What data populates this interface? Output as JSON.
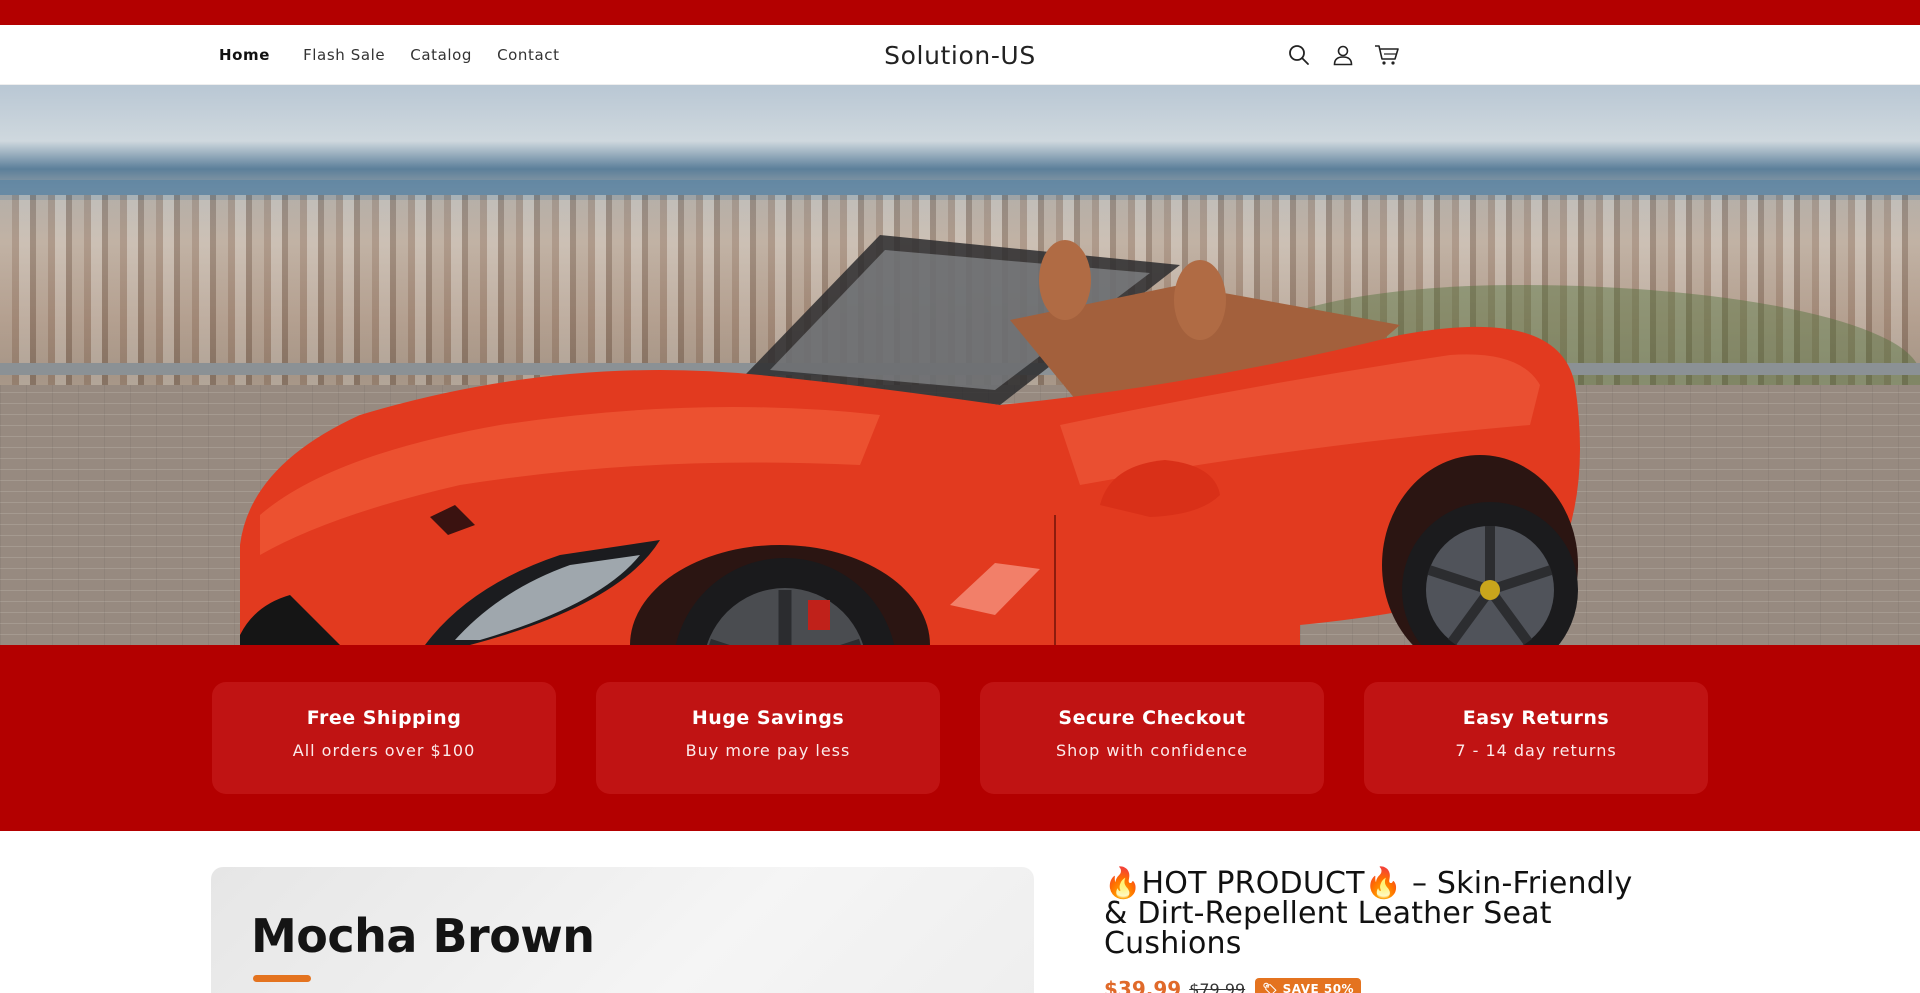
{
  "announcement": {
    "color": "#b30000"
  },
  "header": {
    "logo": "Solution-US",
    "nav": [
      {
        "label": "Home",
        "active": true
      },
      {
        "label": "Flash Sale"
      },
      {
        "label": "Catalog"
      },
      {
        "label": "Contact"
      }
    ],
    "icons": [
      "search-icon",
      "account-icon",
      "cart-icon"
    ]
  },
  "hero": {
    "alt": "red convertible sports car overlooking city"
  },
  "features": [
    {
      "title": "Free Shipping",
      "subtitle": "All orders over $100"
    },
    {
      "title": "Huge Savings",
      "subtitle": "Buy more pay less"
    },
    {
      "title": "Secure Checkout",
      "subtitle": "Shop with confidence"
    },
    {
      "title": "Easy Returns",
      "subtitle": "7 - 14 day returns"
    }
  ],
  "product": {
    "media_title": "Mocha Brown",
    "title": "🔥HOT PRODUCT🔥 – Skin-Friendly & Dirt-Repellent Leather Seat Cushions",
    "price": "$39.99",
    "compare_price": "$79.99",
    "badge": "🏷 SAVE 50%"
  },
  "colors": {
    "brand": "#b30000",
    "accent": "#e4731f",
    "card": "#c01313"
  }
}
